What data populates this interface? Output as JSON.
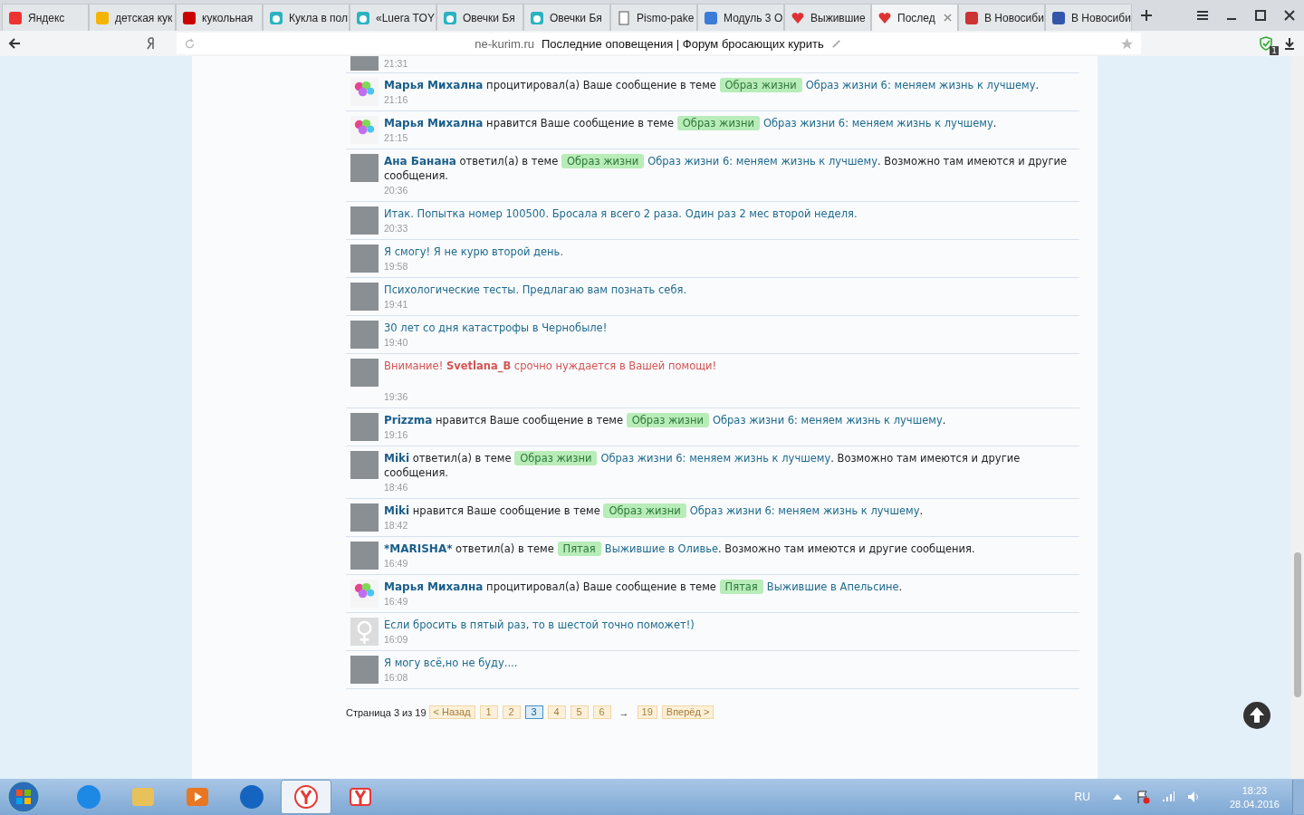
{
  "tabs": [
    {
      "kind": "yandex",
      "title": "Яндекс",
      "selected": false
    },
    {
      "kind": "image",
      "title": "детская кук",
      "selected": false
    },
    {
      "kind": "p",
      "title": "кукольная",
      "selected": false
    },
    {
      "kind": "bear",
      "title": "Кукла в пол",
      "selected": false
    },
    {
      "kind": "bear",
      "title": "«Luera TOY",
      "selected": false
    },
    {
      "kind": "bear",
      "title": "Овечки Бя",
      "selected": false
    },
    {
      "kind": "bear",
      "title": "Овечки Бя",
      "selected": false
    },
    {
      "kind": "doc",
      "title": "Pismo-pake",
      "selected": false
    },
    {
      "kind": "module",
      "title": "Модуль 3 О",
      "selected": false
    },
    {
      "kind": "heart",
      "title": "Выжившие",
      "selected": false
    },
    {
      "kind": "heart",
      "title": "Послед",
      "selected": true
    },
    {
      "kind": "news",
      "title": "В Новосиби",
      "selected": false
    },
    {
      "kind": "flag",
      "title": "В Новосиби",
      "selected": false
    }
  ],
  "address_bar": {
    "domain": "ne-kurim.ru",
    "page_title": "Последние оповещения | Форум бросающих курить",
    "badge": "1"
  },
  "notifications": [
    {
      "kind": "photo",
      "time": "21:31"
    },
    {
      "kind": "balloons",
      "time": "21:16",
      "parts": [
        {
          "kind": "user",
          "text": "Марья Михална"
        },
        {
          "kind": "text",
          "text": " процитировал(а) Ваше сообщение в теме "
        },
        {
          "kind": "tag",
          "text": "Образ жизни"
        },
        {
          "kind": "link",
          "text": "Образ жизни 6: меняем жизнь к лучшему"
        },
        {
          "kind": "text",
          "text": "."
        }
      ]
    },
    {
      "kind": "balloons",
      "time": "21:15",
      "parts": [
        {
          "kind": "user",
          "text": "Марья Михална"
        },
        {
          "kind": "text",
          "text": " нравится Ваше сообщение в теме "
        },
        {
          "kind": "tag",
          "text": "Образ жизни"
        },
        {
          "kind": "link",
          "text": "Образ жизни 6: меняем жизнь к лучшему"
        },
        {
          "kind": "text",
          "text": "."
        }
      ]
    },
    {
      "kind": "photo",
      "time": "20:36",
      "parts": [
        {
          "kind": "user",
          "text": "Ана Банана"
        },
        {
          "kind": "text",
          "text": " ответил(а) в теме "
        },
        {
          "kind": "tag",
          "text": "Образ жизни"
        },
        {
          "kind": "link",
          "text": "Образ жизни 6: меняем жизнь к лучшему"
        },
        {
          "kind": "text",
          "text": ". Возможно там имеются и другие сообщения."
        }
      ]
    },
    {
      "kind": "photo",
      "time": "20:33",
      "parts": [
        {
          "kind": "link",
          "text": "Итак. Попытка номер 100500. Бросала я всего 2 раза. Один раз 2 мес второй неделя."
        }
      ]
    },
    {
      "kind": "photo",
      "time": "19:58",
      "parts": [
        {
          "kind": "link",
          "text": "Я смогу! Я не курю второй день."
        }
      ]
    },
    {
      "kind": "photo",
      "time": "19:41",
      "parts": [
        {
          "kind": "link",
          "text": "Психологические тесты. Предлагаю вам познать себя."
        }
      ]
    },
    {
      "kind": "photo",
      "time": "19:40",
      "parts": [
        {
          "kind": "link",
          "text": "30 лет со дня катастрофы в Чернобыле!"
        }
      ]
    },
    {
      "kind": "photo",
      "time": "19:36",
      "parts": [
        {
          "kind": "alert",
          "text": "Внимание! **Svetlana_B** срочно нуждается в Вашей помощи!"
        }
      ]
    },
    {
      "kind": "photo",
      "time": "19:16",
      "parts": [
        {
          "kind": "user",
          "text": "Prizzma"
        },
        {
          "kind": "text",
          "text": " нравится Ваше сообщение в теме "
        },
        {
          "kind": "tag",
          "text": "Образ жизни"
        },
        {
          "kind": "link",
          "text": "Образ жизни 6: меняем жизнь к лучшему"
        },
        {
          "kind": "text",
          "text": "."
        }
      ]
    },
    {
      "kind": "photo",
      "time": "18:46",
      "parts": [
        {
          "kind": "user",
          "text": "Miki"
        },
        {
          "kind": "text",
          "text": " ответил(а) в теме "
        },
        {
          "kind": "tag",
          "text": "Образ жизни"
        },
        {
          "kind": "link",
          "text": "Образ жизни 6: меняем жизнь к лучшему"
        },
        {
          "kind": "text",
          "text": ". Возможно там имеются и другие сообщения."
        }
      ]
    },
    {
      "kind": "photo",
      "time": "18:42",
      "parts": [
        {
          "kind": "user",
          "text": "Miki"
        },
        {
          "kind": "text",
          "text": " нравится Ваше сообщение в теме "
        },
        {
          "kind": "tag",
          "text": "Образ жизни"
        },
        {
          "kind": "link",
          "text": "Образ жизни 6: меняем жизнь к лучшему"
        },
        {
          "kind": "text",
          "text": "."
        }
      ]
    },
    {
      "kind": "photo",
      "time": "16:49",
      "parts": [
        {
          "kind": "user",
          "text": "*MARISHA*"
        },
        {
          "kind": "text",
          "text": " ответил(а) в теме "
        },
        {
          "kind": "tag",
          "text": "Пятая"
        },
        {
          "kind": "link",
          "text": "Выжившие в Оливье"
        },
        {
          "kind": "text",
          "text": ". Возможно там имеются и другие сообщения."
        }
      ]
    },
    {
      "kind": "balloons",
      "time": "16:49",
      "parts": [
        {
          "kind": "user",
          "text": "Марья Михална"
        },
        {
          "kind": "text",
          "text": " процитировал(а) Ваше сообщение в теме "
        },
        {
          "kind": "tag",
          "text": "Пятая"
        },
        {
          "kind": "link",
          "text": "Выжившие в Апельсине"
        },
        {
          "kind": "text",
          "text": "."
        }
      ]
    },
    {
      "kind": "female",
      "time": "16:09",
      "parts": [
        {
          "kind": "link",
          "text": "Если бросить в пятый раз, то в шестой точно поможет!)"
        }
      ]
    },
    {
      "kind": "photo",
      "time": "16:08",
      "parts": [
        {
          "kind": "link",
          "text": "Я могу всё,но не буду...."
        }
      ]
    }
  ],
  "pagination": {
    "label": "Страница 3 из 19",
    "items": [
      {
        "kind": "nav",
        "text": "< Назад"
      },
      {
        "kind": "page",
        "text": "1",
        "selected": false
      },
      {
        "kind": "page",
        "text": "2",
        "selected": false
      },
      {
        "kind": "page",
        "text": "3",
        "selected": true
      },
      {
        "kind": "page",
        "text": "4",
        "selected": false
      },
      {
        "kind": "page",
        "text": "5",
        "selected": false
      },
      {
        "kind": "page",
        "text": "6",
        "selected": false
      },
      {
        "kind": "gap",
        "text": "→"
      },
      {
        "kind": "page",
        "text": "19",
        "selected": false
      },
      {
        "kind": "nav",
        "text": "Вперёд >"
      }
    ]
  },
  "taskbar": {
    "apps": [
      {
        "kind": "ie",
        "selected": false
      },
      {
        "kind": "folder",
        "selected": false
      },
      {
        "kind": "media",
        "selected": false
      },
      {
        "kind": "circle",
        "selected": false
      },
      {
        "kind": "y",
        "selected": true
      },
      {
        "kind": "ya",
        "selected": false
      }
    ],
    "language": "RU",
    "time": "18:23",
    "date": "28.04.2016"
  }
}
